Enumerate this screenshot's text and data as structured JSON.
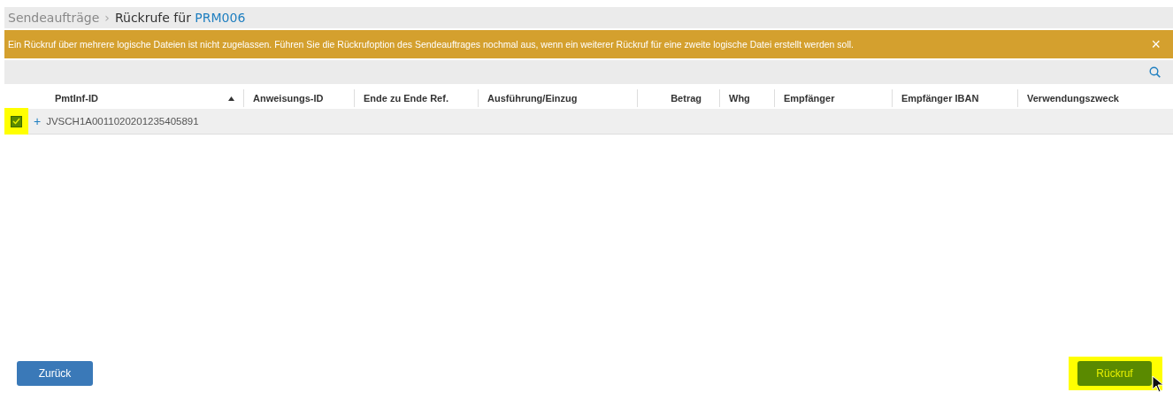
{
  "breadcrumb": {
    "parent": "Sendeaufträge",
    "separator": "›",
    "title": "Rückrufe für",
    "id": "PRM006"
  },
  "alert": {
    "message": "Ein Rückruf über mehrere logische Dateien ist nicht zugelassen. Führen Sie die Rückrufoption des Sendeauftrages nochmal aus, wenn ein weiterer Rückruf für eine zweite logische Datei erstellt werden soll.",
    "close": "×"
  },
  "table": {
    "columns": [
      {
        "label": "PmtInf-ID",
        "sorted": true,
        "kind": "text"
      },
      {
        "label": "Anweisungs-ID",
        "sorted": false,
        "kind": "text"
      },
      {
        "label": "Ende zu Ende Ref.",
        "sorted": false,
        "kind": "text"
      },
      {
        "label": "Ausführung/Einzug",
        "sorted": false,
        "kind": "text"
      },
      {
        "label": "Betrag",
        "sorted": false,
        "kind": "amount"
      },
      {
        "label": "Whg",
        "sorted": false,
        "kind": "text"
      },
      {
        "label": "Empfänger",
        "sorted": false,
        "kind": "text"
      },
      {
        "label": "Empfänger IBAN",
        "sorted": false,
        "kind": "text"
      },
      {
        "label": "Verwendungszweck",
        "sorted": false,
        "kind": "text"
      }
    ],
    "rows": [
      {
        "checked": true,
        "highlighted": true,
        "expand": "+",
        "pmtinf_id": "JVSCH1A0011020201235405891"
      }
    ]
  },
  "buttons": [
    {
      "label": "Zurück",
      "kind": "secondary",
      "highlighted": false
    },
    {
      "label": "Rückruf",
      "kind": "primary",
      "highlighted": true
    }
  ]
}
